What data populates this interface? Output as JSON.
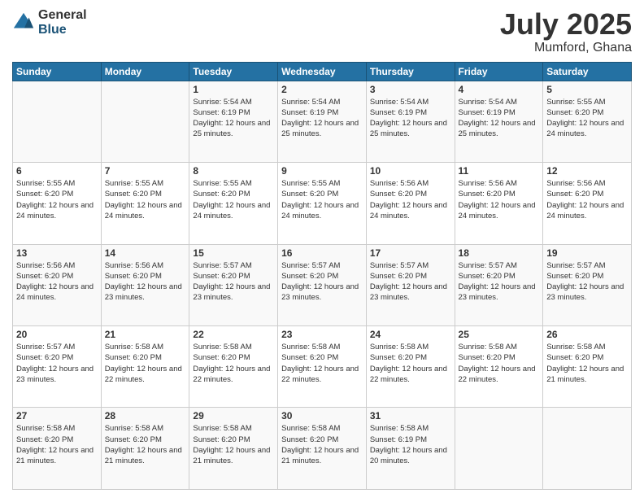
{
  "header": {
    "logo_general": "General",
    "logo_blue": "Blue",
    "month_title": "July 2025",
    "location": "Mumford, Ghana"
  },
  "calendar": {
    "days_of_week": [
      "Sunday",
      "Monday",
      "Tuesday",
      "Wednesday",
      "Thursday",
      "Friday",
      "Saturday"
    ],
    "weeks": [
      [
        {
          "day": "",
          "info": ""
        },
        {
          "day": "",
          "info": ""
        },
        {
          "day": "1",
          "info": "Sunrise: 5:54 AM\nSunset: 6:19 PM\nDaylight: 12 hours and 25 minutes."
        },
        {
          "day": "2",
          "info": "Sunrise: 5:54 AM\nSunset: 6:19 PM\nDaylight: 12 hours and 25 minutes."
        },
        {
          "day": "3",
          "info": "Sunrise: 5:54 AM\nSunset: 6:19 PM\nDaylight: 12 hours and 25 minutes."
        },
        {
          "day": "4",
          "info": "Sunrise: 5:54 AM\nSunset: 6:19 PM\nDaylight: 12 hours and 25 minutes."
        },
        {
          "day": "5",
          "info": "Sunrise: 5:55 AM\nSunset: 6:20 PM\nDaylight: 12 hours and 24 minutes."
        }
      ],
      [
        {
          "day": "6",
          "info": "Sunrise: 5:55 AM\nSunset: 6:20 PM\nDaylight: 12 hours and 24 minutes."
        },
        {
          "day": "7",
          "info": "Sunrise: 5:55 AM\nSunset: 6:20 PM\nDaylight: 12 hours and 24 minutes."
        },
        {
          "day": "8",
          "info": "Sunrise: 5:55 AM\nSunset: 6:20 PM\nDaylight: 12 hours and 24 minutes."
        },
        {
          "day": "9",
          "info": "Sunrise: 5:55 AM\nSunset: 6:20 PM\nDaylight: 12 hours and 24 minutes."
        },
        {
          "day": "10",
          "info": "Sunrise: 5:56 AM\nSunset: 6:20 PM\nDaylight: 12 hours and 24 minutes."
        },
        {
          "day": "11",
          "info": "Sunrise: 5:56 AM\nSunset: 6:20 PM\nDaylight: 12 hours and 24 minutes."
        },
        {
          "day": "12",
          "info": "Sunrise: 5:56 AM\nSunset: 6:20 PM\nDaylight: 12 hours and 24 minutes."
        }
      ],
      [
        {
          "day": "13",
          "info": "Sunrise: 5:56 AM\nSunset: 6:20 PM\nDaylight: 12 hours and 24 minutes."
        },
        {
          "day": "14",
          "info": "Sunrise: 5:56 AM\nSunset: 6:20 PM\nDaylight: 12 hours and 23 minutes."
        },
        {
          "day": "15",
          "info": "Sunrise: 5:57 AM\nSunset: 6:20 PM\nDaylight: 12 hours and 23 minutes."
        },
        {
          "day": "16",
          "info": "Sunrise: 5:57 AM\nSunset: 6:20 PM\nDaylight: 12 hours and 23 minutes."
        },
        {
          "day": "17",
          "info": "Sunrise: 5:57 AM\nSunset: 6:20 PM\nDaylight: 12 hours and 23 minutes."
        },
        {
          "day": "18",
          "info": "Sunrise: 5:57 AM\nSunset: 6:20 PM\nDaylight: 12 hours and 23 minutes."
        },
        {
          "day": "19",
          "info": "Sunrise: 5:57 AM\nSunset: 6:20 PM\nDaylight: 12 hours and 23 minutes."
        }
      ],
      [
        {
          "day": "20",
          "info": "Sunrise: 5:57 AM\nSunset: 6:20 PM\nDaylight: 12 hours and 23 minutes."
        },
        {
          "day": "21",
          "info": "Sunrise: 5:58 AM\nSunset: 6:20 PM\nDaylight: 12 hours and 22 minutes."
        },
        {
          "day": "22",
          "info": "Sunrise: 5:58 AM\nSunset: 6:20 PM\nDaylight: 12 hours and 22 minutes."
        },
        {
          "day": "23",
          "info": "Sunrise: 5:58 AM\nSunset: 6:20 PM\nDaylight: 12 hours and 22 minutes."
        },
        {
          "day": "24",
          "info": "Sunrise: 5:58 AM\nSunset: 6:20 PM\nDaylight: 12 hours and 22 minutes."
        },
        {
          "day": "25",
          "info": "Sunrise: 5:58 AM\nSunset: 6:20 PM\nDaylight: 12 hours and 22 minutes."
        },
        {
          "day": "26",
          "info": "Sunrise: 5:58 AM\nSunset: 6:20 PM\nDaylight: 12 hours and 21 minutes."
        }
      ],
      [
        {
          "day": "27",
          "info": "Sunrise: 5:58 AM\nSunset: 6:20 PM\nDaylight: 12 hours and 21 minutes."
        },
        {
          "day": "28",
          "info": "Sunrise: 5:58 AM\nSunset: 6:20 PM\nDaylight: 12 hours and 21 minutes."
        },
        {
          "day": "29",
          "info": "Sunrise: 5:58 AM\nSunset: 6:20 PM\nDaylight: 12 hours and 21 minutes."
        },
        {
          "day": "30",
          "info": "Sunrise: 5:58 AM\nSunset: 6:20 PM\nDaylight: 12 hours and 21 minutes."
        },
        {
          "day": "31",
          "info": "Sunrise: 5:58 AM\nSunset: 6:19 PM\nDaylight: 12 hours and 20 minutes."
        },
        {
          "day": "",
          "info": ""
        },
        {
          "day": "",
          "info": ""
        }
      ]
    ]
  }
}
